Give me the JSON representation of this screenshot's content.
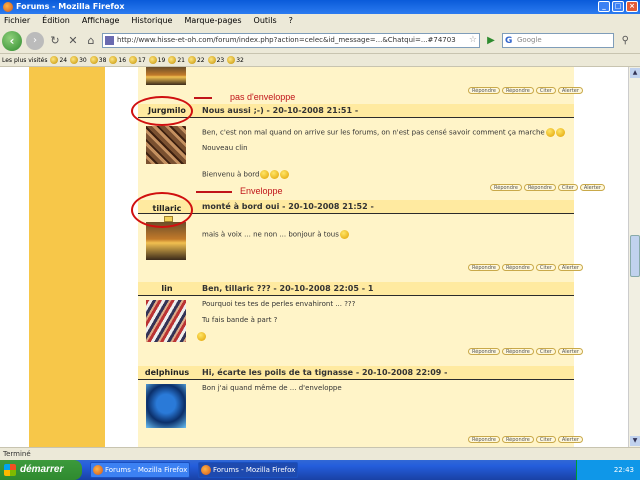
{
  "window": {
    "title": "Forums - Mozilla Firefox"
  },
  "menu": [
    "Fichier",
    "Édition",
    "Affichage",
    "Historique",
    "Marque-pages",
    "Outils",
    "?"
  ],
  "nav": {
    "url": "http://www.hisse-et-oh.com/forum/index.php?action=celec&id_message=...&Chatqui=...#74703",
    "search_placeholder": "Google"
  },
  "bookmarks": [
    "Les plus visités",
    "24",
    "30",
    "38",
    "16",
    "17",
    "19",
    "21",
    "22",
    "23",
    "32"
  ],
  "annotations": {
    "no_envelope": "pas d'enveloppe",
    "envelope": "Enveloppe"
  },
  "posts": [
    {
      "author": "Jurgmilo",
      "title": "Nous aussi ;-) - 20-10-2008 21:51 -",
      "lines": [
        "Ben, c'est non mal quand on arrive sur les forums, on n'est pas censé savoir comment ça marche",
        "Nouveau clin",
        "Bienvenu à bord"
      ]
    },
    {
      "author": "tillaric",
      "title": "monté à bord oui - 20-10-2008 21:52 -",
      "lines": [
        "mais à voix ... ne non ... bonjour à tous"
      ]
    },
    {
      "author": "lin",
      "title": "Ben, tillaric ??? - 20-10-2008 22:05 - 1",
      "lines": [
        "Pourquoi tes tes de perles envahiront ... ???",
        "Tu fais bande à part ?"
      ]
    },
    {
      "author": "delphinus",
      "title": "Hi, écarte les poils de ta tignasse - 20-10-2008 22:09 -",
      "lines": [
        "Bon j'ai quand même de ... d'enveloppe"
      ]
    }
  ],
  "post_buttons": [
    "Répondre",
    "Répondre",
    "Citer",
    "Alerter"
  ],
  "status": "Terminé",
  "taskbar": {
    "start": "démarrer",
    "tasks": [
      "Forums - Mozilla Firefox",
      "Forums - Mozilla Firefox"
    ],
    "clock": "22:43"
  }
}
